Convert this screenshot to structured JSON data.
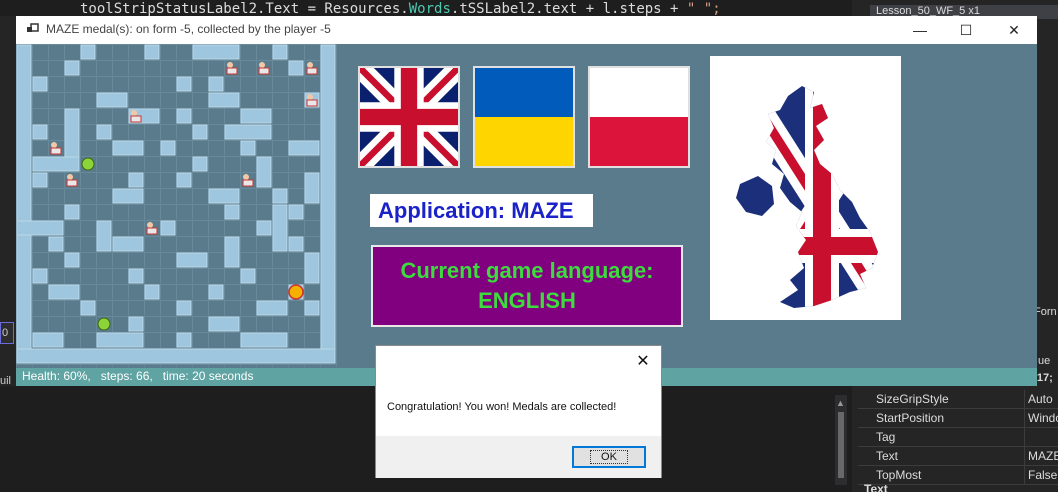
{
  "ide": {
    "code_prefix": "toolStripStatusLabel2.Text = Resources.",
    "code_class": "Words",
    "code_mid": ".tSSLabel2.text + l.steps + ",
    "code_str": "\" \";",
    "right_tab": "Lesson_50_WF_5 x1",
    "left_marker": "0",
    "left_frag": "uil",
    "right_frag_form": "Forn",
    "right_frag_true": "ue",
    "right_frag_num": ".:017;",
    "properties": [
      {
        "key": "SizeGripStyle",
        "value": "Auto"
      },
      {
        "key": "StartPosition",
        "value": "Windo"
      },
      {
        "key": "Tag",
        "value": ""
      },
      {
        "key": "Text",
        "value": "MAZE"
      },
      {
        "key": "TopMost",
        "value": "False"
      }
    ],
    "prop_section": "Text"
  },
  "window": {
    "title": "MAZE  medal(s): on form -5, collected by the player -5",
    "minimize": "—",
    "maximize": "☐",
    "close": "✕"
  },
  "app_label": "Application: MAZE",
  "language": {
    "line1": "Current game language:",
    "line2": "ENGLISH"
  },
  "status": {
    "text": "Health: 60%,   steps: 66,   time: 20 seconds"
  },
  "dialog": {
    "close": "✕",
    "message": "Congratulation! You won! Medals are collected!",
    "ok": "OK"
  },
  "colors": {
    "maze_bg": "#5a7b8c",
    "brick": "#9fc6df",
    "status_bar": "#5fa3a3",
    "app_label_text": "#1a22c8",
    "language_bg": "#800080",
    "language_text": "#3ddc3d"
  }
}
